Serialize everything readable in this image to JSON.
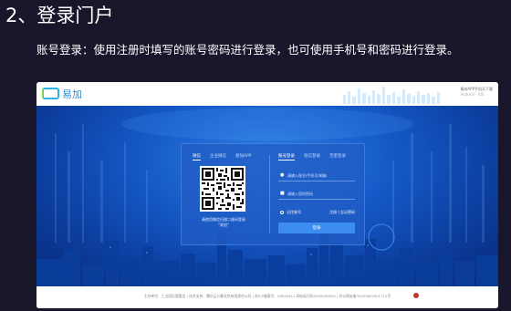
{
  "slide": {
    "title": "2、登录门户",
    "description": "账号登录：使用注册时填写的账号密码进行登录，也可使用手机号和密码进行登录。"
  },
  "portal": {
    "brand": "易加",
    "header_right_title": "青岛APP手机天下载",
    "header_right_sub": "Android · iOS",
    "qr_tabs": [
      "微信",
      "企业微信",
      "易加APP"
    ],
    "login_tabs": [
      "账号登录",
      "短信登录",
      "无密登录"
    ],
    "qr_caption_line1": "请使用微信扫描二维码登录",
    "qr_caption_line2": "\"易加\"",
    "username_placeholder": "请输入账号/手机号/邮箱",
    "password_placeholder": "请输入您的密码",
    "remember_label": "记住账号",
    "links_text": "注册 | 忘记密码",
    "login_button": "登录",
    "footer": "主办单位：工业园区管委会 | 技术支持：腾讯云计算北京有限责任公司 | 苏ICP备案号：00040411 网站标识码3200000020 | 苏公网安备32059002001711号"
  },
  "colors": {
    "slide_bg": "#17162b",
    "hero": "#1458c6",
    "button": "#3d8df0",
    "brand": "#2b8fd6"
  }
}
